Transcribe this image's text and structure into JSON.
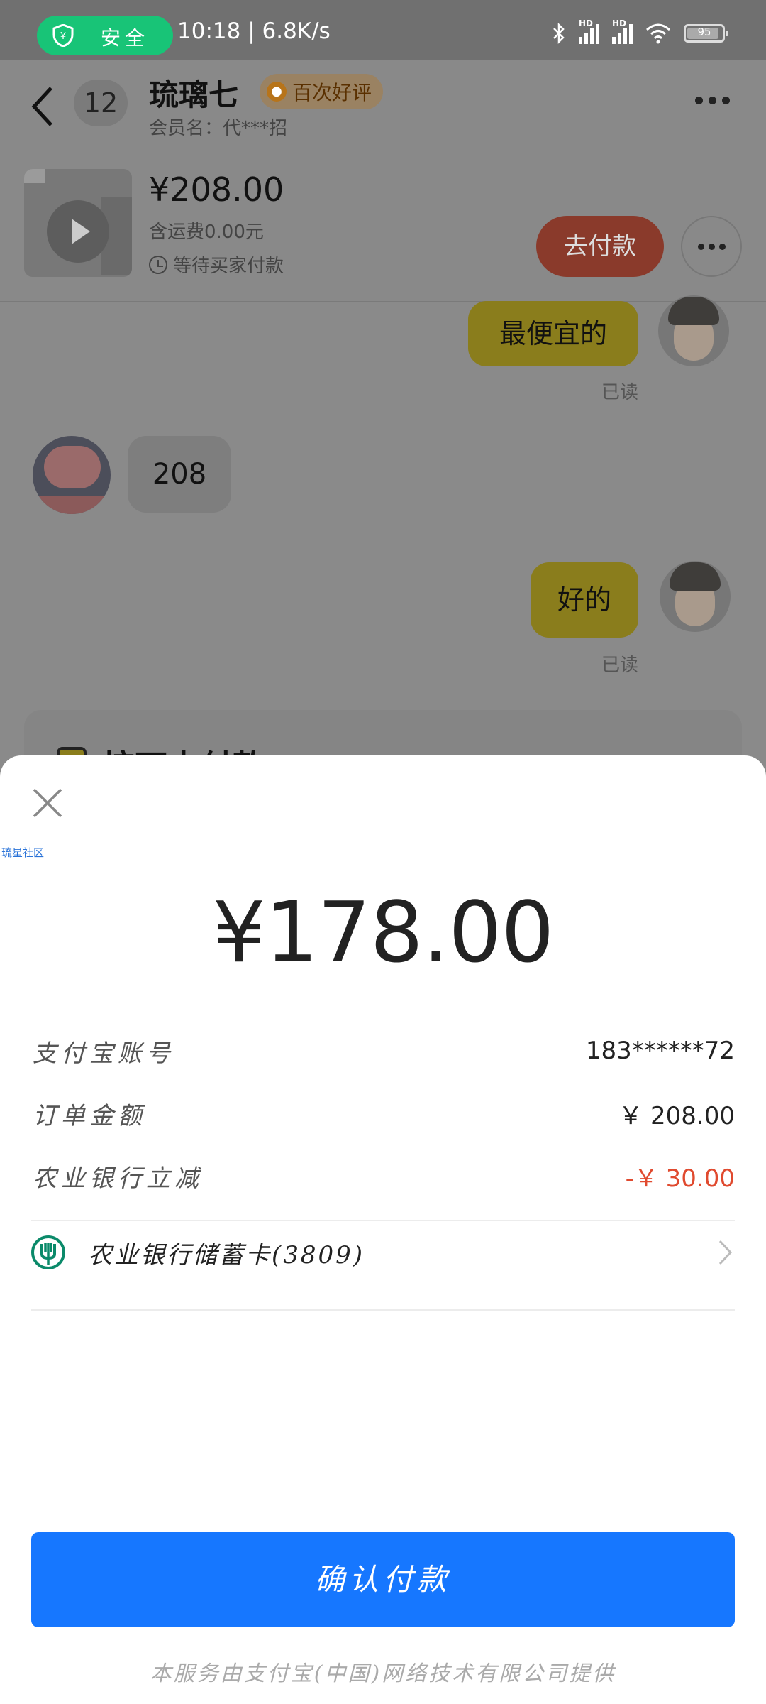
{
  "status_bar": {
    "safe_label": "安全",
    "time": "10:18",
    "speed": "6.8K/s",
    "signal_1": "HD",
    "signal_2": "HD",
    "battery": "95"
  },
  "chat_header": {
    "unread_count": "12",
    "name": "琉璃七",
    "praise_badge": "百次好评",
    "member": "会员名：代***招"
  },
  "order": {
    "price": "¥208.00",
    "shipping": "含运费0.00元",
    "status": "等待买家付款",
    "pay_button": "去付款"
  },
  "messages": [
    {
      "side": "right",
      "text": "最便宜的",
      "read": "已读"
    },
    {
      "side": "left",
      "text": "208"
    },
    {
      "side": "right",
      "text": "好的",
      "read": "已读"
    }
  ],
  "peek_card": {
    "title": "按下支付款"
  },
  "payment_sheet": {
    "watermark": "琉星社区",
    "amount": "¥178.00",
    "rows": [
      {
        "label": "支付宝账号",
        "value": "183******72"
      },
      {
        "label": "订单金额",
        "value": "￥ 208.00"
      },
      {
        "label": "农业银行立减",
        "value": "-￥ 30.00"
      }
    ],
    "bank_card": "农业银行储蓄卡(3809)",
    "confirm_button": "确认付款",
    "footer": "本服务由支付宝(中国)网络技术有限公司提供"
  },
  "colors": {
    "primary_blue": "#1677ff",
    "discount_red": "#e04a2f",
    "safe_green": "#18c477",
    "bank_green": "#0b8a6a"
  }
}
